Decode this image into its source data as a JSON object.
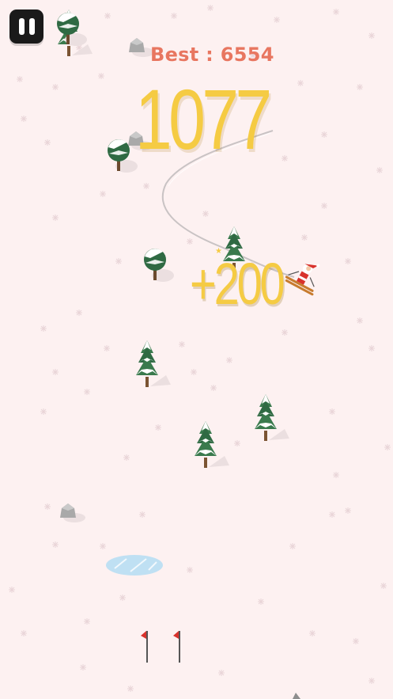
{
  "hud": {
    "best_label": "Best :",
    "best_value": "6554",
    "score": "1077",
    "bonus_popup": "+200"
  },
  "controls": {
    "pause_icon": "pause-icon"
  },
  "colors": {
    "snow": "#fdf1f1",
    "score": "#f5cb43",
    "best": "#e87660",
    "pause_button": "#1a1a1a",
    "flag": "#d8322c",
    "ice": "#bfe0f3"
  }
}
